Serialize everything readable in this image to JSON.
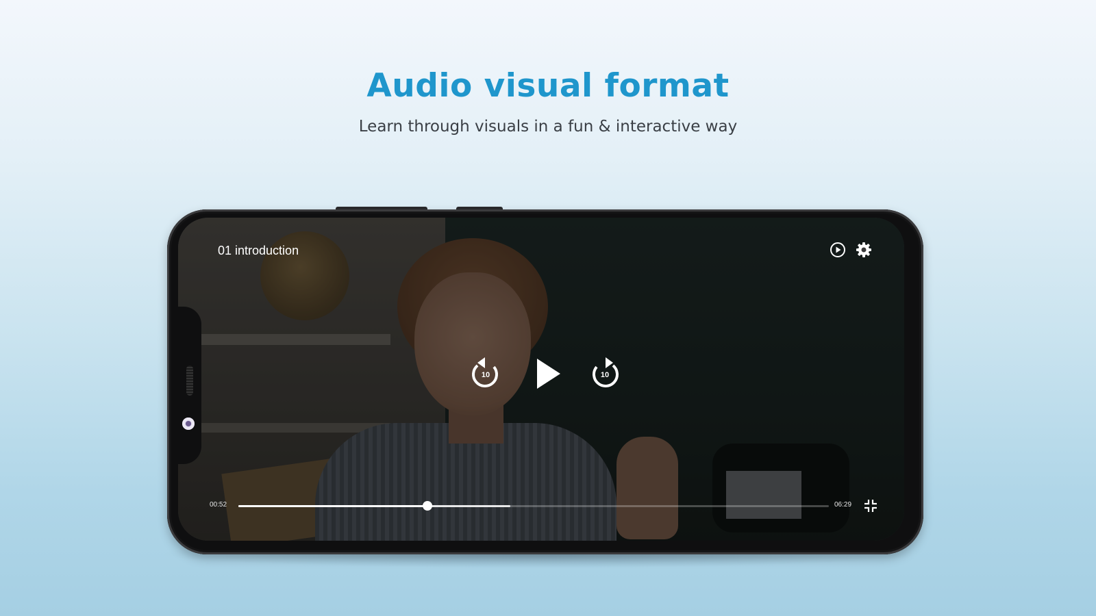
{
  "headline": "Audio visual format",
  "subline": "Learn through visuals in a fun & interactive way",
  "player": {
    "title": "01 introduction",
    "current_time": "00:52",
    "duration": "06:29",
    "progress_fraction": 0.32,
    "buffered_fraction": 0.46,
    "rewind_seconds": "10",
    "forward_seconds": "10"
  },
  "icons": {
    "playback_speed": "play-circle-icon",
    "settings": "gear-icon",
    "rewind": "rewind-10-icon",
    "play": "play-icon",
    "forward": "forward-10-icon",
    "fullscreen": "fullscreen-exit-icon"
  },
  "colors": {
    "headline": "#1f96cc",
    "subline": "#3a3f45",
    "controls": "#ffffff"
  }
}
